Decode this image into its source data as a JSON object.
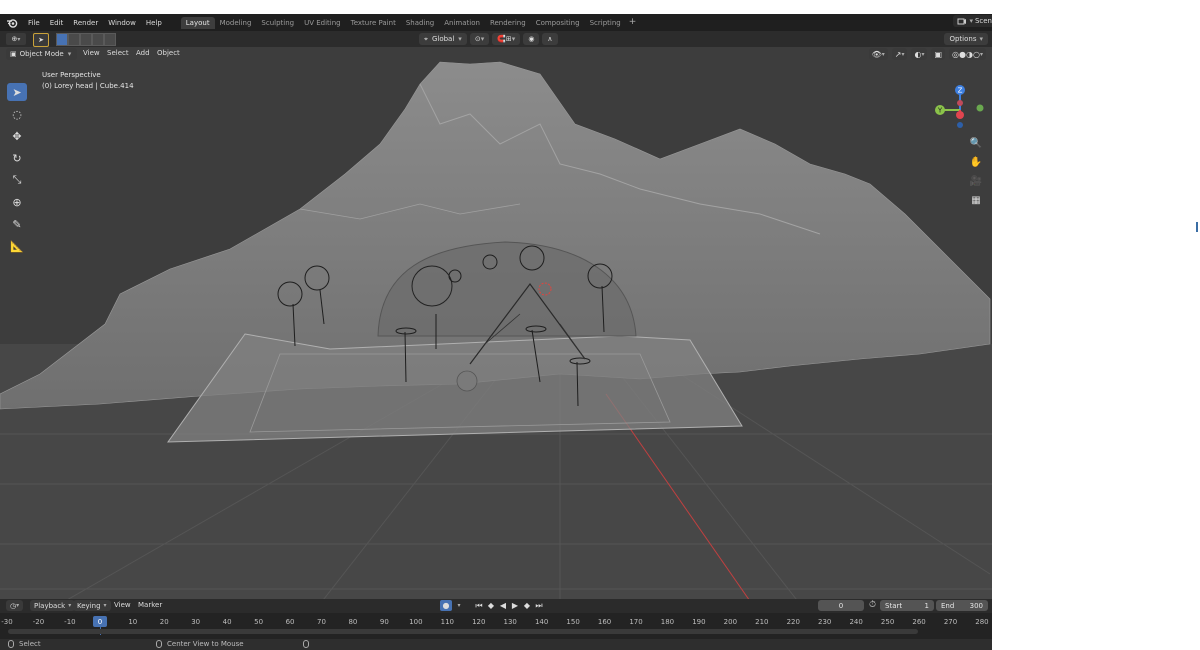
{
  "topbar": {
    "menus": [
      "File",
      "Edit",
      "Render",
      "Window",
      "Help"
    ],
    "workspaces": [
      "Layout",
      "Modeling",
      "Sculpting",
      "UV Editing",
      "Texture Paint",
      "Shading",
      "Animation",
      "Rendering",
      "Compositing",
      "Scripting"
    ],
    "active_workspace": "Layout",
    "add_label": "+",
    "scene_label": "Scen"
  },
  "tool_header": {
    "orientation": "Global",
    "options_label": "Options"
  },
  "viewport_header": {
    "mode": "Object Mode",
    "menus": [
      "View",
      "Select",
      "Add",
      "Object"
    ]
  },
  "viewport": {
    "perspective_label": "User Perspective",
    "object_info": "(0) Lorey head | Cube.414",
    "gizmo": {
      "z_label": "Z",
      "y_label": "Y",
      "x_color": "#e0454f",
      "y_color": "#8bc34a",
      "z_color": "#3d7fe0"
    }
  },
  "timeline": {
    "menus": {
      "playback": "Playback",
      "keying": "Keying",
      "view": "View",
      "marker": "Marker"
    },
    "current_frame": "0",
    "start_label": "Start",
    "start_value": "1",
    "end_label": "End",
    "end_value": "300",
    "ruler_ticks": [
      "-30",
      "-20",
      "-10",
      "0",
      "10",
      "20",
      "30",
      "40",
      "50",
      "60",
      "70",
      "80",
      "90",
      "100",
      "110",
      "120",
      "130",
      "140",
      "150",
      "160",
      "170",
      "180",
      "190",
      "200",
      "210",
      "220",
      "230",
      "240",
      "250",
      "260",
      "270",
      "280"
    ],
    "ruler_current": "0"
  },
  "statusbar": {
    "select_label": "Select",
    "center_view_label": "Center View to Mouse"
  },
  "colors": {
    "accent": "#4772b3",
    "background": "#1d1d1d",
    "viewport_bg": "#3d3d3d"
  }
}
